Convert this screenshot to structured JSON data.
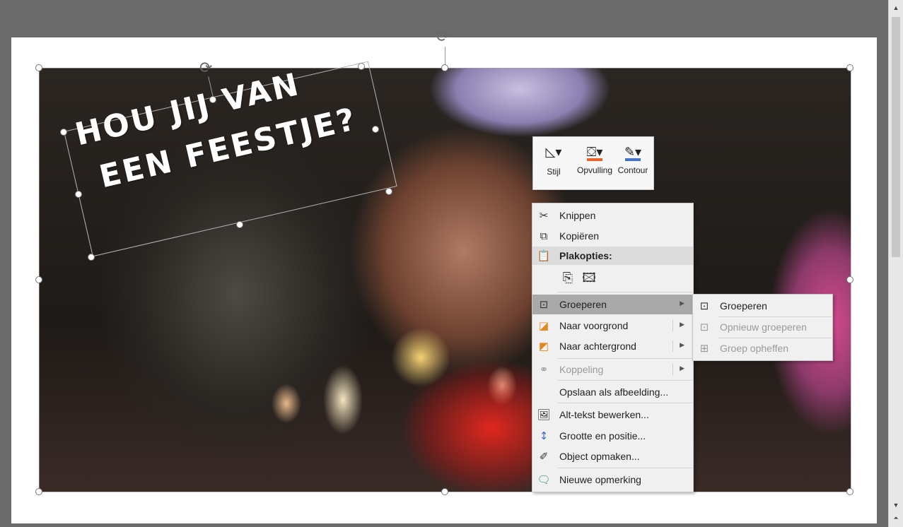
{
  "slide": {
    "headline_line1": "HOU JIJ VAN",
    "headline_line2": "EEN FEESTJE?"
  },
  "mini_toolbar": {
    "buttons": [
      {
        "label": "Stijl",
        "icon": "style-icon"
      },
      {
        "label": "Opvulling",
        "icon": "fill-bucket-icon",
        "color": "#e8632a"
      },
      {
        "label": "Contour",
        "icon": "outline-pen-icon",
        "color": "#4472c4"
      }
    ]
  },
  "context_menu": {
    "cut": "Knippen",
    "copy": "Kopiëren",
    "paste_options_header": "Plakopties:",
    "group": "Groeperen",
    "bring_forward": "Naar voorgrond",
    "send_backward": "Naar achtergrond",
    "link": "Koppeling",
    "save_as_picture": "Opslaan als afbeelding...",
    "edit_alt_text": "Alt-tekst bewerken...",
    "size_position": "Grootte en positie...",
    "format_object": "Object opmaken...",
    "new_comment": "Nieuwe opmerking"
  },
  "group_submenu": {
    "group": "Groeperen",
    "regroup": "Opnieuw groeperen",
    "ungroup": "Groep opheffen"
  },
  "colors": {
    "workspace": "#6b6b6b",
    "menu_bg": "#f0f0f0",
    "menu_highlight": "#a9a9a9"
  }
}
